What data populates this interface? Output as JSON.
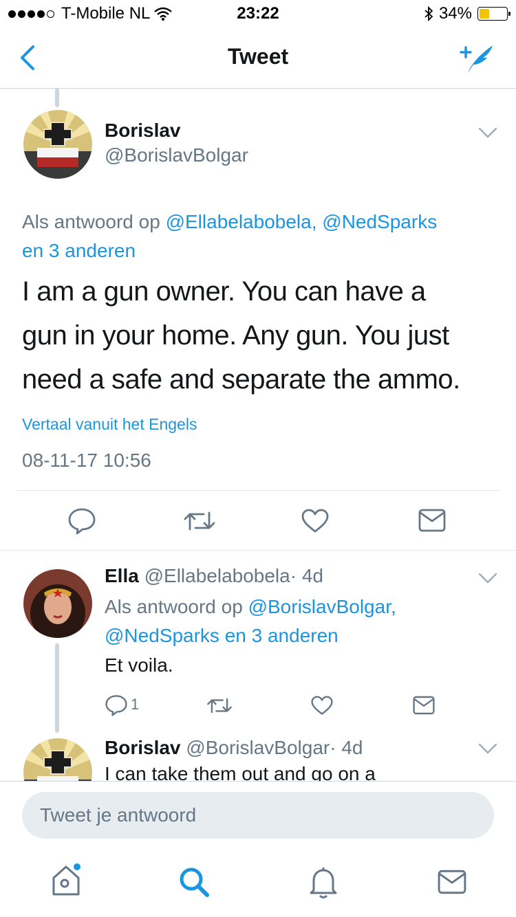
{
  "status_bar": {
    "carrier": "T-Mobile NL",
    "time": "23:22",
    "battery": "34%",
    "battery_level": 0.34
  },
  "nav": {
    "title": "Tweet"
  },
  "main_tweet": {
    "name": "Borislav",
    "handle": "@BorislavBolgar",
    "reply_prefix": "Als antwoord op",
    "reply_line1_links": "@Ellabelabobela, @NedSparks",
    "reply_line2": "en 3 anderen",
    "text_lines": [
      "I am a gun owner. You can have a",
      "gun in your home. Any gun. You just",
      "need a safe and separate the ammo."
    ],
    "translate": "Vertaal vanuit het Engels",
    "timestamp": "08-11-17 10:56"
  },
  "reply_1": {
    "name": "Ella",
    "handle": "@Ellabelabobela",
    "age": "· 4d",
    "reply_prefix": "Als antwoord op",
    "reply_link1": "@BorislavBolgar,",
    "reply_line2": "@NedSparks en 3 anderen",
    "text": "Et voila.",
    "reply_count": "1"
  },
  "reply_2": {
    "name": "Borislav",
    "handle": "@BorislavBolgar",
    "age": "· 4d",
    "text": "I can take them out and go on a"
  },
  "composer": {
    "placeholder": "Tweet je antwoord"
  },
  "colors": {
    "accent": "#1b95e0",
    "muted": "#657786",
    "divider": "#e1e8ed"
  },
  "icons": {
    "nav": [
      "back-chevron-icon",
      "compose-tweet-icon"
    ],
    "actions": [
      "reply-icon",
      "retweet-icon",
      "like-icon",
      "direct-message-icon"
    ],
    "tabs": [
      "home-icon",
      "search-icon",
      "notifications-icon",
      "messages-icon"
    ]
  }
}
